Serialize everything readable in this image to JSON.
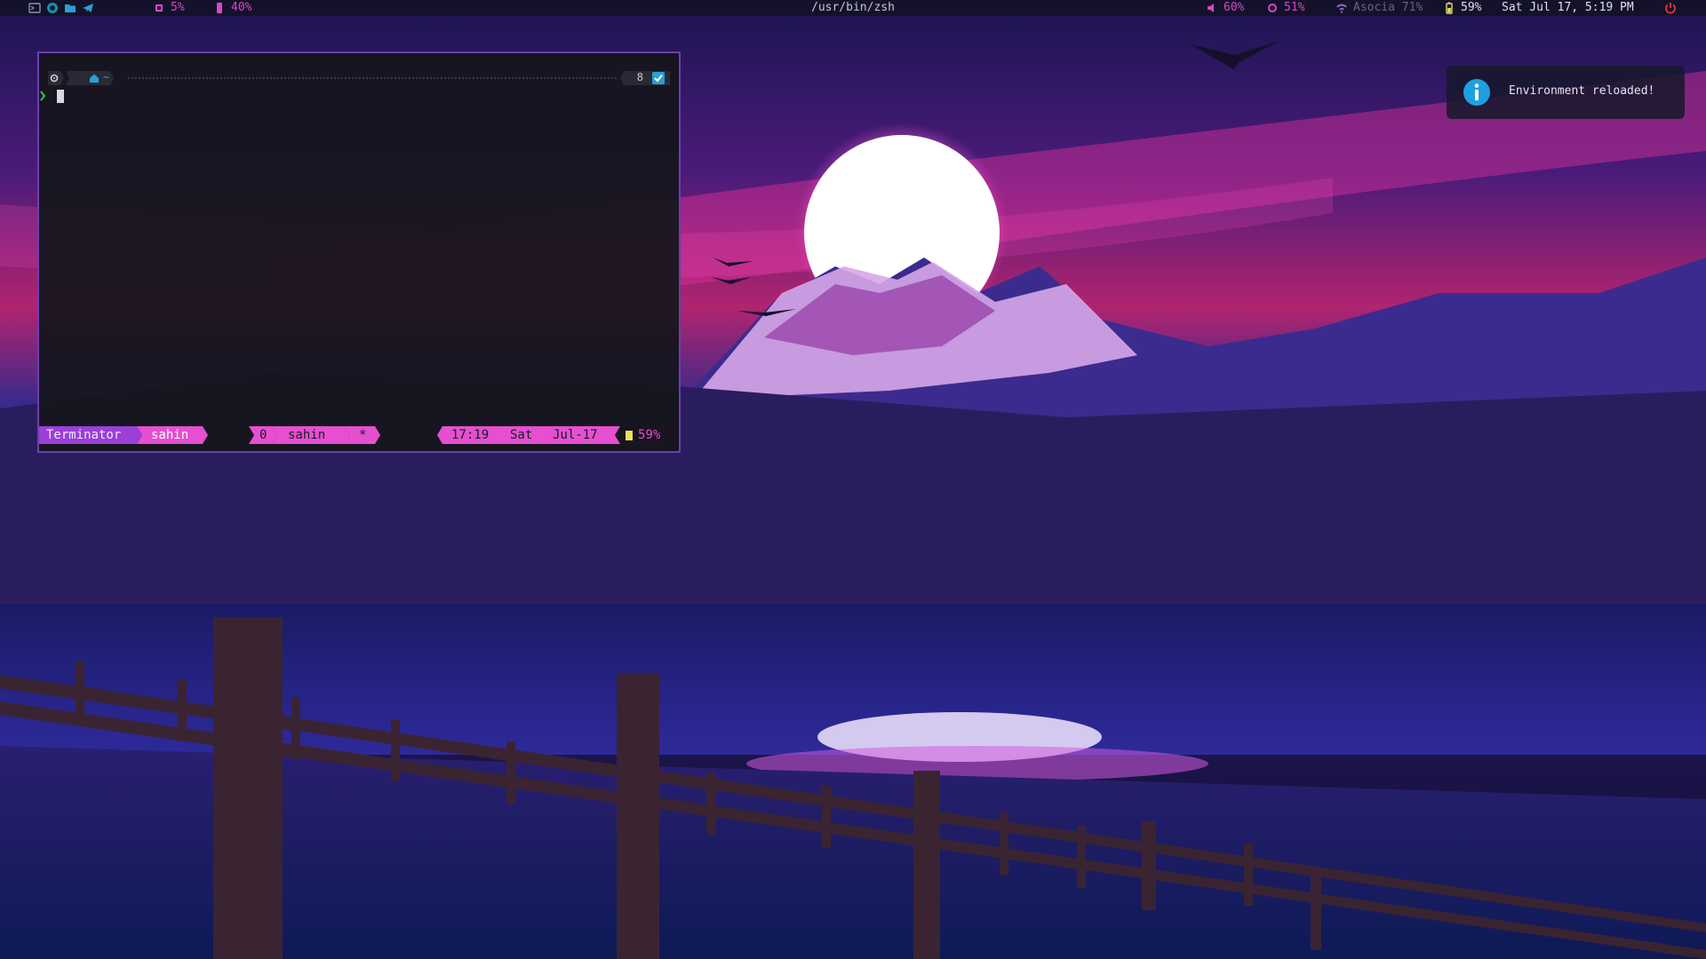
{
  "topbar": {
    "workspace_pct_1": "5%",
    "workspace_pct_2": "40%",
    "window_title": "/usr/bin/zsh",
    "volume": "60%",
    "brightness": "51%",
    "wifi": "Asocia 71%",
    "battery": "59%",
    "datetime": "Sat Jul 17,  5:19 PM"
  },
  "terminal": {
    "prompt_dir": "~",
    "right_count": "8",
    "status": {
      "app": "Terminator",
      "user": "sahin",
      "win_index": "0",
      "win_name": "sahin",
      "win_flag": "*",
      "time": "17:19",
      "day": "Sat",
      "date": "Jul-17",
      "battery": "59%"
    }
  },
  "notification": {
    "text": "Environment reloaded!"
  },
  "colors": {
    "accent": "#d946c7",
    "pink_segment": "#e54fd0",
    "purple_segment": "#9b3fd8",
    "info_blue": "#1ea0e0"
  }
}
